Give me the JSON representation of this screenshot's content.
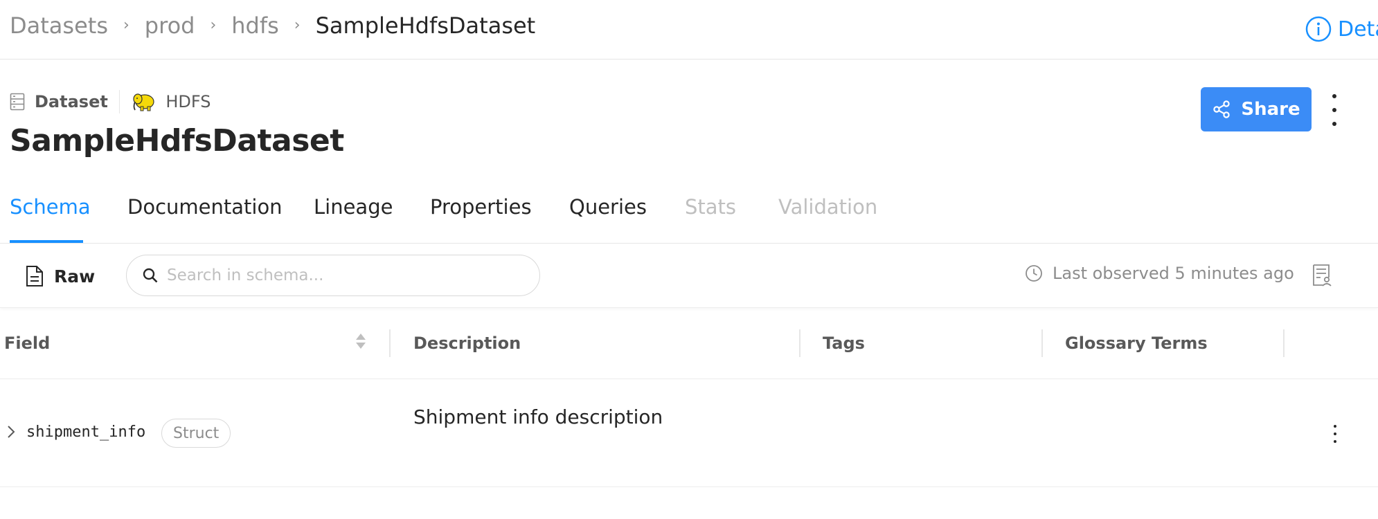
{
  "breadcrumb": {
    "items": [
      "Datasets",
      "prod",
      "hdfs",
      "SampleHdfsDataset"
    ],
    "separator": "›"
  },
  "details_link": "Deta",
  "entity": {
    "type_label": "Dataset",
    "platform_label": "HDFS",
    "title": "SampleHdfsDataset"
  },
  "actions": {
    "share_label": "Share"
  },
  "tabs": [
    {
      "label": "Schema",
      "state": "active"
    },
    {
      "label": "Documentation",
      "state": "enabled"
    },
    {
      "label": "Lineage",
      "state": "enabled"
    },
    {
      "label": "Properties",
      "state": "enabled"
    },
    {
      "label": "Queries",
      "state": "enabled"
    },
    {
      "label": "Stats",
      "state": "disabled"
    },
    {
      "label": "Validation",
      "state": "disabled"
    }
  ],
  "toolbar": {
    "raw_label": "Raw",
    "search_placeholder": "Search in schema...",
    "last_observed": "Last observed 5 minutes ago"
  },
  "table": {
    "columns": [
      "Field",
      "Description",
      "Tags",
      "Glossary Terms"
    ],
    "rows": [
      {
        "field": "shipment_info",
        "type": "Struct",
        "description": "Shipment info description",
        "tags": "",
        "glossary_terms": ""
      }
    ]
  },
  "colors": {
    "accent": "#1890ff",
    "share_button": "#3b8cf6",
    "disabled_tab": "#bfbfbf"
  },
  "icons": {
    "details": "info-circle-icon",
    "dataset": "database-icon",
    "platform": "hdfs-elephant-logo",
    "share": "share-icon",
    "raw": "file-text-icon",
    "search": "search-icon",
    "clock": "clock-icon",
    "schema_blame": "file-blame-icon",
    "expand": "chevron-right-icon"
  }
}
